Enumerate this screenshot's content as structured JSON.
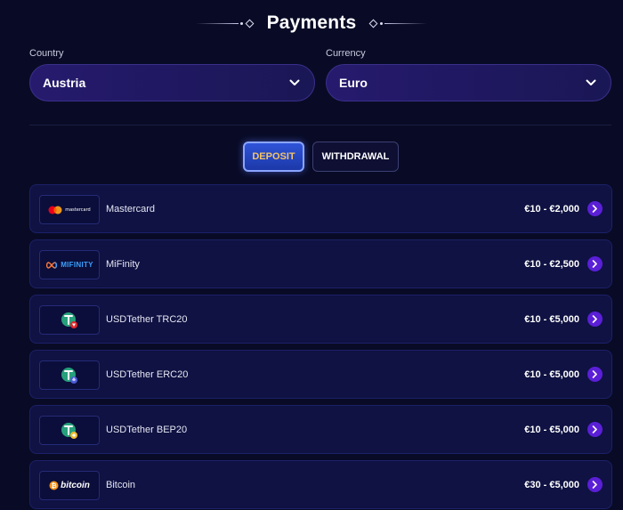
{
  "title": "Payments",
  "country": {
    "label": "Country",
    "value": "Austria"
  },
  "currency": {
    "label": "Currency",
    "value": "Euro"
  },
  "tabs": {
    "deposit": "DEPOSIT",
    "withdrawal": "WITHDRAWAL",
    "active": "deposit"
  },
  "methods": [
    {
      "name": "Mastercard",
      "range": "€10 - €2,000",
      "logo_text": "mastercard",
      "icon": "mastercard-logo"
    },
    {
      "name": "MiFinity",
      "range": "€10 - €2,500",
      "logo_text": "MIFINITY",
      "icon": "mifinity-logo"
    },
    {
      "name": "USDTether TRC20",
      "range": "€10 - €5,000",
      "icon": "tether-trc20-icon"
    },
    {
      "name": "USDTether ERC20",
      "range": "€10 - €5,000",
      "icon": "tether-erc20-icon"
    },
    {
      "name": "USDTether BEP20",
      "range": "€10 - €5,000",
      "icon": "tether-bep20-icon"
    },
    {
      "name": "Bitcoin",
      "range": "€30 - €5,000",
      "logo_text": "bitcoin",
      "icon": "bitcoin-logo"
    }
  ],
  "colors": {
    "background": "#090b26",
    "select_bg": "#261a6e",
    "deposit_tab": "#2f54d8",
    "deposit_text": "#f2c46a",
    "arrow_button": "#5a1fd6",
    "tether_green": "#26a17b"
  }
}
